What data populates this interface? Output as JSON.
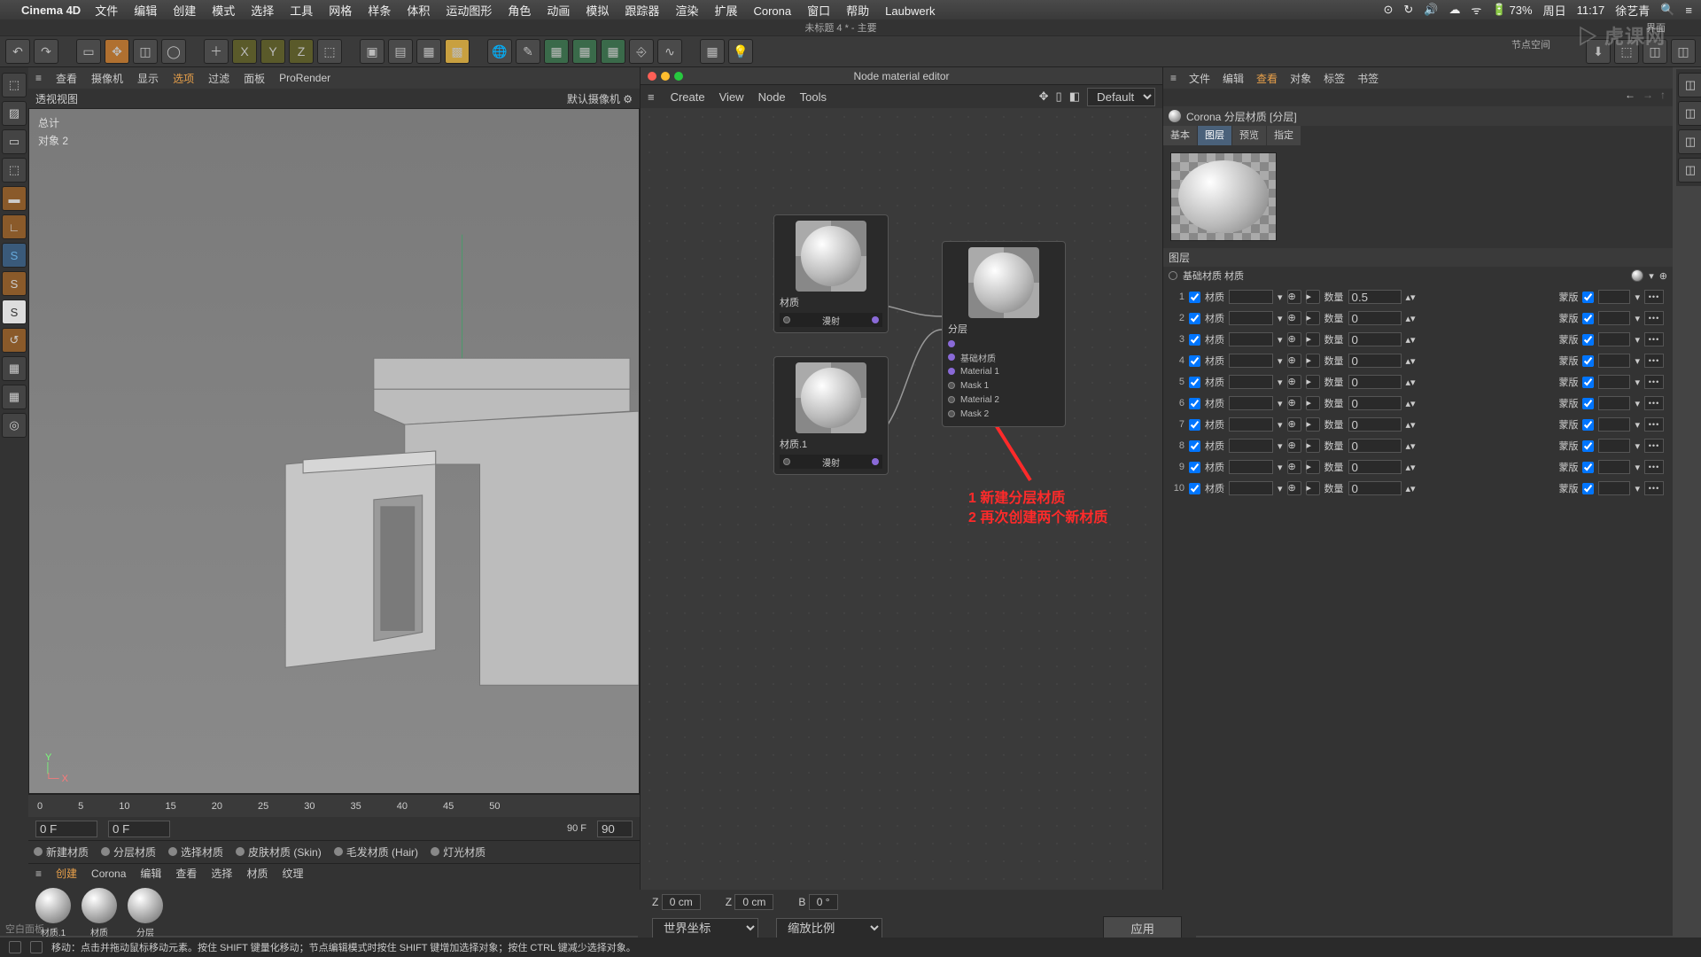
{
  "mac": {
    "app": "Cinema 4D",
    "menus": [
      "文件",
      "编辑",
      "创建",
      "模式",
      "选择",
      "工具",
      "网格",
      "样条",
      "体积",
      "运动图形",
      "角色",
      "动画",
      "模拟",
      "跟踪器",
      "渲染",
      "扩展",
      "Corona",
      "窗口",
      "帮助",
      "Laubwerk"
    ],
    "right": {
      "battery": "73%",
      "day": "周日",
      "time": "11:17",
      "user": "徐艺青"
    }
  },
  "title_strip": {
    "left": "未标题 4 * - 主要",
    "right_a": "界面",
    "right_b": "节点空间"
  },
  "toolbar_icons": [
    "undo",
    "redo",
    "|",
    "live-sel",
    "move",
    "scale",
    "rotate",
    "|",
    "add",
    "x-axis",
    "y-axis",
    "z-axis",
    "world",
    "|",
    "rec",
    "play",
    "cam",
    "vr",
    "|",
    "globe",
    "brush",
    "fx1",
    "fx2",
    "fx3",
    "link",
    "curve",
    "|",
    "grid",
    "bulb"
  ],
  "view_menus": {
    "items": [
      "查看",
      "摄像机",
      "显示",
      "选项",
      "过滤",
      "面板",
      "ProRender"
    ],
    "active_idx": 3
  },
  "view_label": {
    "left": "透视视图",
    "right": "默认摄像机"
  },
  "obj_info": {
    "l1": "总计",
    "l2": "对象  2"
  },
  "axis": {
    "y": "Y",
    "x": "X"
  },
  "timeline_ticks": [
    "0",
    "5",
    "10",
    "15",
    "20",
    "25",
    "30",
    "35",
    "40",
    "45",
    "50"
  ],
  "frame_row": {
    "a": "0 F",
    "b": "0 F",
    "c": "90 F",
    "d": "90"
  },
  "material_types": [
    "新建材质",
    "分层材质",
    "选择材质",
    "皮肤材质 (Skin)",
    "毛发材质 (Hair)",
    "灯光材质"
  ],
  "mat_menu": {
    "items": [
      "创建",
      "Corona",
      "编辑",
      "查看",
      "选择",
      "材质",
      "纹理"
    ],
    "active_idx": 0
  },
  "mat_shelf": [
    "材质.1",
    "材质",
    "分层"
  ],
  "node_editor": {
    "title": "Node material editor",
    "menus": [
      "Create",
      "View",
      "Node",
      "Tools"
    ],
    "preset": "Default",
    "nodes": {
      "mat1": {
        "label": "材质",
        "port": "漫射"
      },
      "mat2": {
        "label": "材质.1",
        "port": "漫射"
      },
      "layer": {
        "label": "分层",
        "ports": [
          "基础材质",
          "Material 1",
          "Mask 1",
          "Material 2",
          "Mask 2"
        ]
      }
    },
    "annot1": "1  新建分层材质",
    "annot2": "2  再次创建两个新材质"
  },
  "attr": {
    "head": [
      "文件",
      "编辑",
      "查看",
      "对象",
      "标签",
      "书签"
    ],
    "head_active": 2,
    "title": "Corona 分层材质 [分层]",
    "tabs": [
      "基本",
      "图层",
      "预览",
      "指定"
    ],
    "tab_sel": 1,
    "section": "图层",
    "base_label": "基础材质  材质",
    "col_mat": "材质",
    "col_qty": "数量",
    "col_mask": "蒙版",
    "rows": [
      {
        "i": "1",
        "qty": "0.5"
      },
      {
        "i": "2",
        "qty": "0"
      },
      {
        "i": "3",
        "qty": "0"
      },
      {
        "i": "4",
        "qty": "0"
      },
      {
        "i": "5",
        "qty": "0"
      },
      {
        "i": "6",
        "qty": "0"
      },
      {
        "i": "7",
        "qty": "0"
      },
      {
        "i": "8",
        "qty": "0"
      },
      {
        "i": "9",
        "qty": "0"
      },
      {
        "i": "10",
        "qty": "0"
      }
    ]
  },
  "coords": {
    "z1l": "Z",
    "z1": "0 cm",
    "z2l": "Z",
    "z2": "0 cm",
    "bl": "B",
    "b": "0 °"
  },
  "apply": {
    "a": "世界坐标",
    "b": "缩放比例",
    "btn": "应用"
  },
  "blank_panel": "空白面板",
  "status": "移动：点击并拖动鼠标移动元素。按住 SHIFT 键量化移动；节点编辑模式时按住 SHIFT 键增加选择对象；按住 CTRL 键减少选择对象。",
  "watermark": "虎课网"
}
